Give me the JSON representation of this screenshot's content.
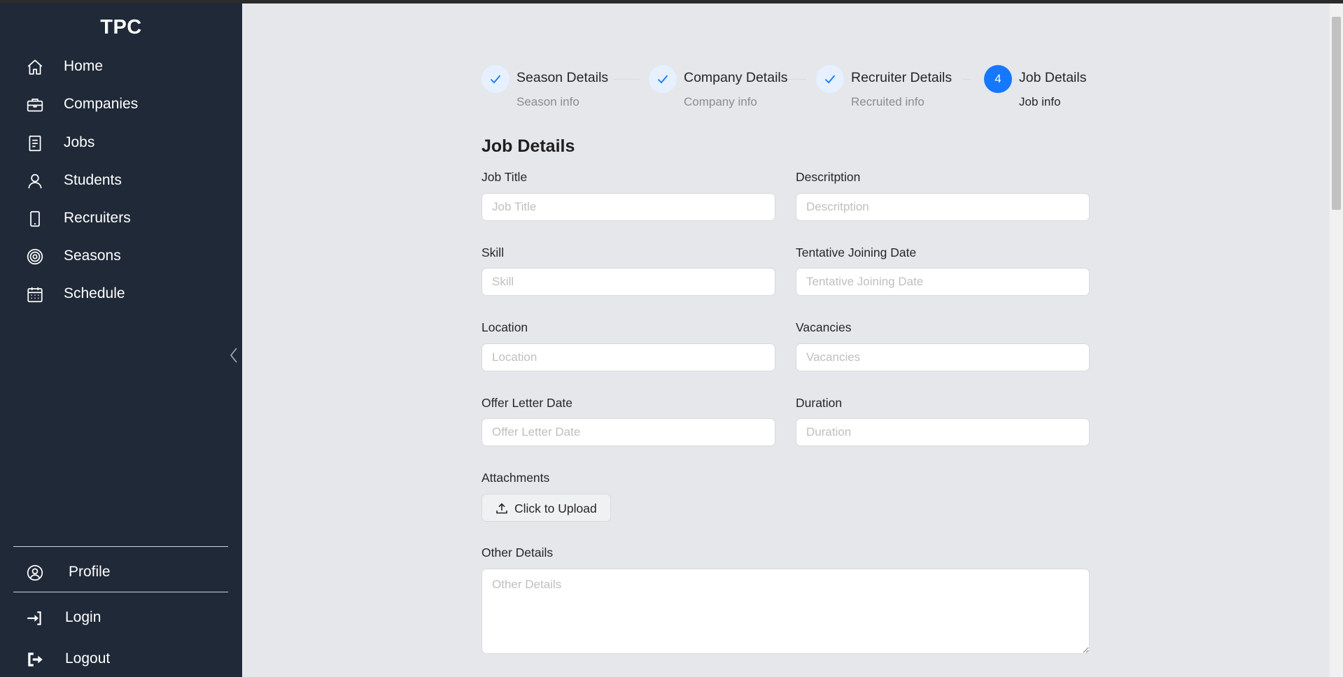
{
  "app": {
    "brand": "TPC"
  },
  "sidebar": {
    "items": [
      {
        "label": "Home",
        "icon": "home-icon"
      },
      {
        "label": "Companies",
        "icon": "briefcase-icon"
      },
      {
        "label": "Jobs",
        "icon": "document-icon"
      },
      {
        "label": "Students",
        "icon": "user-icon"
      },
      {
        "label": "Recruiters",
        "icon": "phone-icon"
      },
      {
        "label": "Seasons",
        "icon": "target-icon"
      },
      {
        "label": "Schedule",
        "icon": "calendar-icon"
      }
    ],
    "bottom": [
      {
        "label": "Profile",
        "icon": "user-circle-icon"
      },
      {
        "label": "Login",
        "icon": "login-icon"
      },
      {
        "label": "Logout",
        "icon": "logout-icon"
      }
    ]
  },
  "steps": [
    {
      "title": "Season Details",
      "subtitle": "Season info",
      "status": "done"
    },
    {
      "title": "Company Details",
      "subtitle": "Company info",
      "status": "done"
    },
    {
      "title": "Recruiter Details",
      "subtitle": "Recruited info",
      "status": "done"
    },
    {
      "number": "4",
      "title": "Job Details",
      "subtitle": "Job info",
      "status": "active"
    }
  ],
  "form": {
    "title": "Job Details",
    "job_title": {
      "label": "Job Title",
      "placeholder": "Job Title",
      "value": ""
    },
    "description": {
      "label": "Descritption",
      "placeholder": "Descritption",
      "value": ""
    },
    "skill": {
      "label": "Skill",
      "placeholder": "Skill",
      "value": ""
    },
    "joining_date": {
      "label": "Tentative Joining Date",
      "placeholder": "Tentative Joining Date",
      "value": ""
    },
    "location": {
      "label": "Location",
      "placeholder": "Location",
      "value": ""
    },
    "vacancies": {
      "label": "Vacancies",
      "placeholder": "Vacancies",
      "value": ""
    },
    "offer_date": {
      "label": "Offer Letter Date",
      "placeholder": "Offer Letter Date",
      "value": ""
    },
    "duration": {
      "label": "Duration",
      "placeholder": "Duration",
      "value": ""
    },
    "attachments": {
      "label": "Attachments",
      "button": "Click to Upload"
    },
    "other_details": {
      "label": "Other Details",
      "placeholder": "Other Details",
      "value": ""
    }
  },
  "colors": {
    "sidebar_bg": "#1f2937",
    "page_bg": "#e5e7eb",
    "accent": "#1677ff"
  }
}
